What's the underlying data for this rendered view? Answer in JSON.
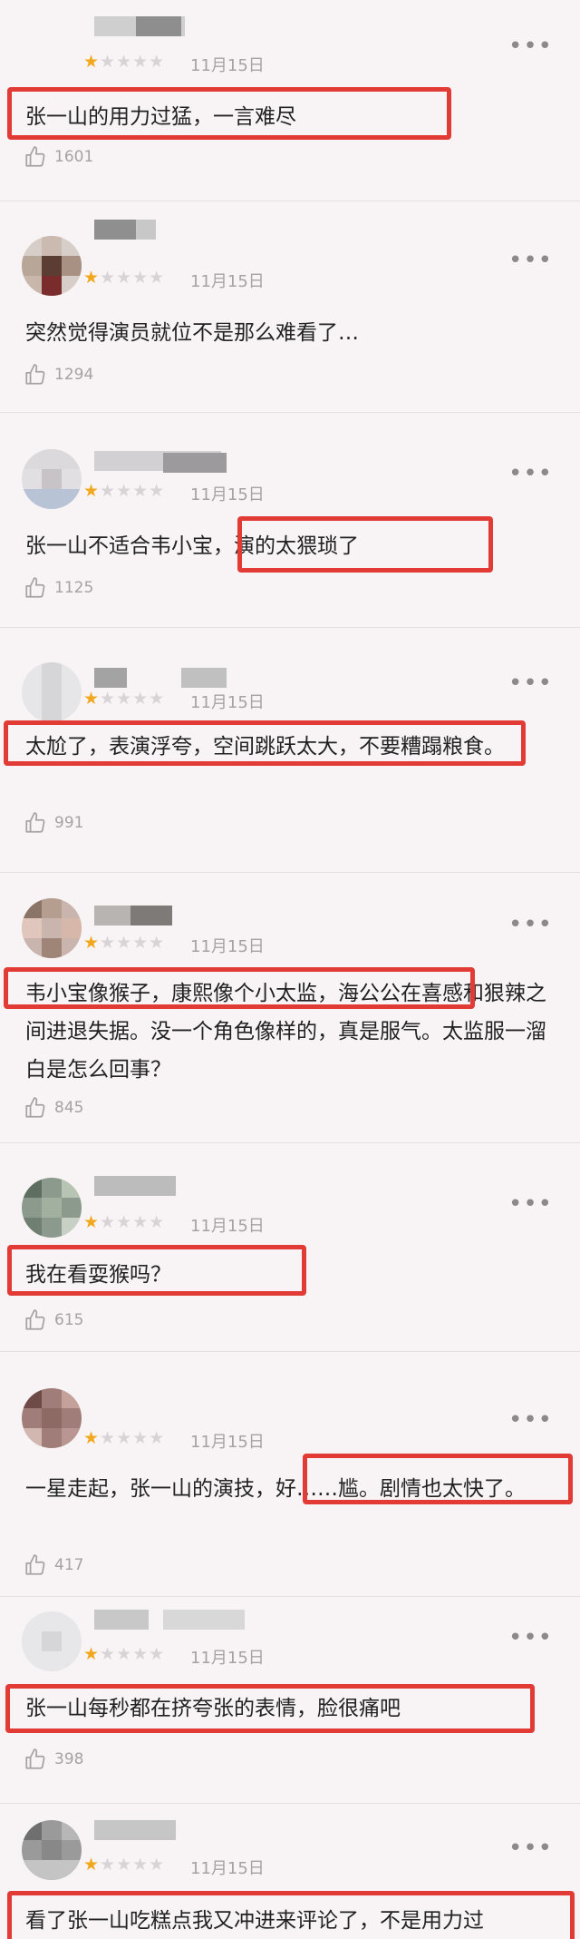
{
  "comments": [
    {
      "stars": 1,
      "date": "11月15日",
      "more": "•••",
      "text": "张一山的用力过猛，一言难尽",
      "likes": "1601",
      "highlight": "张一山的用力过猛，一言难尽"
    },
    {
      "stars": 1,
      "date": "11月15日",
      "more": "•••",
      "text": "突然觉得演员就位不是那么难看了…",
      "likes": "1294"
    },
    {
      "stars": 1,
      "date": "11月15日",
      "more": "•••",
      "text": "张一山不适合韦小宝，演的太猥琐了",
      "likes": "1125",
      "highlight": "演的太猥琐了"
    },
    {
      "stars": 1,
      "date": "11月15日",
      "more": "•••",
      "text": "太尬了，表演浮夸，空间跳跃太大，不要糟蹋粮食。",
      "likes": "991",
      "highlight": "太尬了，表演浮夸，空间跳跃太大，不要糟蹋粮"
    },
    {
      "stars": 1,
      "date": "11月15日",
      "more": "•••",
      "text": "韦小宝像猴子，康熙像个小太监，海公公在喜感和狠辣之间进退失据。没一个角色像样的，真是服气。太监服一溜白是怎么回事？",
      "likes": "845",
      "highlight": "韦小宝像猴子，康熙像个小太监，海公公"
    },
    {
      "stars": 1,
      "date": "11月15日",
      "more": "•••",
      "text": "我在看耍猴吗？",
      "likes": "615",
      "highlight": "我在看耍猴吗？"
    },
    {
      "stars": 1,
      "date": "11月15日",
      "more": "•••",
      "text": "一星走起，张一山的演技，好……尴。剧情也太快了。",
      "likes": "417",
      "highlight": "好……尴。剧情也太快"
    },
    {
      "stars": 1,
      "date": "11月15日",
      "more": "•••",
      "text": "张一山每秒都在挤夸张的表情，脸很痛吧",
      "likes": "398",
      "highlight": "张一山每秒都在挤夸张的表情，脸很痛吧"
    },
    {
      "stars": 1,
      "date": "11月15日",
      "more": "•••",
      "text": "看了张一山吃糕点我又冲进来评论了，不是用力过",
      "highlight": "看了张一山吃糕点我又冲进来评论了，不是用力过"
    }
  ],
  "colors": {
    "star_on": "#f2a81d",
    "star_off": "#d8d4d5",
    "highlight": "#e23b36"
  },
  "icons": {
    "like": "thumb-up-icon",
    "more": "more-options-icon",
    "star": "star-icon"
  }
}
